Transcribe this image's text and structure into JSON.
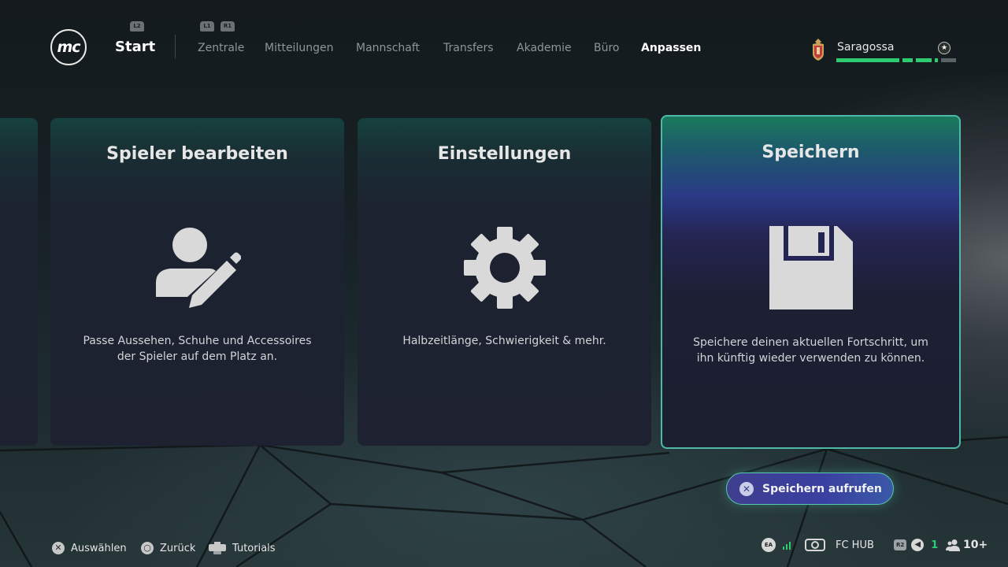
{
  "header": {
    "logo_text": "mc",
    "hint_l2": "L2",
    "hint_l1": "L1",
    "hint_r1": "R1",
    "start_label": "Start",
    "nav": [
      "Zentrale",
      "Mitteilungen",
      "Mannschaft",
      "Transfers",
      "Akademie",
      "Büro",
      "Anpassen"
    ],
    "active_tab": "Anpassen",
    "club_name": "Saragossa",
    "club_star": "★"
  },
  "cards": [
    {
      "title": "Spieler bearbeiten",
      "icon": "edit-player-icon",
      "description": "Passe Aussehen, Schuhe und Accessoires der Spieler auf dem Platz an."
    },
    {
      "title": "Einstellungen",
      "icon": "gear-icon",
      "description": "Halbzeitlänge, Schwierigkeit & mehr."
    },
    {
      "title": "Speichern",
      "icon": "save-disk-icon",
      "description": "Speichere deinen aktuellen Fortschritt, um ihn künftig wieder verwenden zu können.",
      "selected": true
    }
  ],
  "cta": {
    "button_glyph": "✕",
    "label": "Speichern aufrufen"
  },
  "footer": {
    "select_glyph": "✕",
    "select_label": "Auswählen",
    "back_glyph": "○",
    "back_label": "Zurück",
    "tutorials_label": "Tutorials",
    "ea_label": "EA",
    "fc_hub_label": "FC HUB",
    "r2_label": "R2",
    "notification_count": "1",
    "friends_count": "10+"
  },
  "colors": {
    "accent_green": "#2ecc71",
    "selected_border": "#4fb9a8",
    "cta_bg": "#3a3fa0"
  }
}
